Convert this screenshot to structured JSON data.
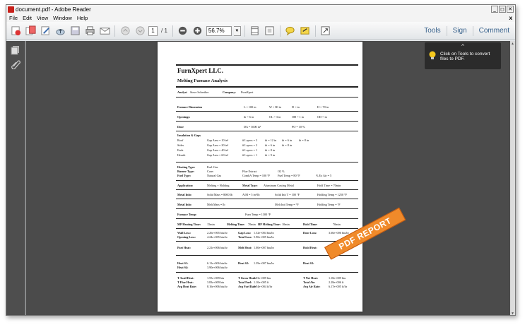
{
  "window": {
    "title": "document.pdf - Adobe Reader",
    "min": "_",
    "max": "◻",
    "close": "✕"
  },
  "menu": {
    "items": [
      "File",
      "Edit",
      "View",
      "Window",
      "Help"
    ],
    "close": "x"
  },
  "toolbar": {
    "page_current": "1",
    "page_total": "/ 1",
    "zoom": "56.7%",
    "zoom_dd": "▼",
    "links": [
      "Tools",
      "Sign",
      "Comment"
    ]
  },
  "tooltip": {
    "chevron": "^",
    "text": "Click on Tools to convert files to PDF."
  },
  "stamp": {
    "text": "PDF REPORT"
  },
  "scroll": {
    "up": "▲",
    "down": "▼"
  },
  "doc": {
    "company": "FurnXpert LLC.",
    "subtitle": "Melting Furnace Analysis",
    "analyst_label": "Analyst",
    "analyst": "Steve Schreiber",
    "company_label": "Company:",
    "company_value": "FurnXpert",
    "furnace_dim": {
      "label": "Furnace Dimension",
      "l": "L = 100 in",
      "w": "W = 80 in",
      "d": "D =  in",
      "h": "H = 70 in"
    },
    "openings": {
      "label": "Openings:",
      "a": "th = 6 in",
      "b": "OL = 3 in",
      "c": "OH = 1 in",
      "d": "OD =  in"
    },
    "door": {
      "label": "Door",
      "da": "DA = 3600 in²",
      "po": "PO = 10  %"
    },
    "insulation": {
      "label": "Insulation & Gaps",
      "rows": [
        [
          "Roof",
          "Gap Area = 10 in²",
          "# Layers = 3",
          "th = 12 in",
          "th = 6 in",
          "th = 8 in"
        ],
        [
          "Sides",
          "Gap Area = 20 in²",
          "# Layers = 2",
          "th = 6 in",
          "th = 8 in",
          ""
        ],
        [
          "Ends",
          "Gap Area = 40 in²",
          "# Layers = 1",
          "th = 8 in",
          "",
          ""
        ],
        [
          "Hearth",
          "Gap Area = 60 in²",
          "# Layers = 1",
          "th = 9 in",
          "",
          ""
        ]
      ]
    },
    "heating": [
      [
        "Heating Type:",
        "Fuel-Gas",
        "",
        "",
        ""
      ],
      [
        "Burner Type:",
        "Conv",
        "Flue Extract",
        "O2 %",
        ""
      ],
      [
        "Fuel Type:",
        "Natural Gas",
        "CombA Temp = 100 °F",
        "Fuel Temp = 80 °F",
        "% Ex Air = 5"
      ]
    ],
    "application": {
      "label": "Application:",
      "value": "Melting + Holding",
      "mt_label": "Metal Type:",
      "mt": "Aluminum Casting Metal",
      "ht": "Hold Time = 70min"
    },
    "metal_info1": {
      "label": "Metal Info:",
      "a": "Solid Mass = 8000 lb",
      "b": "A/M = 5 in²/lb",
      "c": "Solid Init T = 100 °F",
      "d": "Holding Temp = 1250 °F"
    },
    "metal_info2": {
      "label": "Metal Info:",
      "a": "Melt Mass =  lb",
      "c": "Melt Init Temp =  °F",
      "d": "Holding Temp =  °F"
    },
    "furnace_temp": {
      "label": "Furnace Temp:",
      "value": "Furn Temp = 1300 °F"
    },
    "times": {
      "mp_label": "MP Heating Time:",
      "mp": "15min",
      "melt_label": "Melting Time:",
      "melt": "70min",
      "hp_label": "HP Melting Time:",
      "hp": "10min",
      "hold_label": "Hold Time:",
      "hold": "70min"
    },
    "losses": [
      [
        "Wall Loss:",
        "2.26e+005 btu/hr",
        "Gap Loss:",
        "1.52e+004 btu/hr",
        "Door Loss:",
        "3.66e+006 btu/hr"
      ],
      [
        "Opening Loss:",
        "4.24e+005 btu/hr",
        "Total Loss:",
        "5.90e+005 btu/hr",
        "",
        ""
      ]
    ],
    "heats": [
      [
        "Part Heat:",
        "2.21e+006 btu/hr",
        "Melt Heat:",
        "1.00e+007 btu/hr",
        "Hold Heat:",
        "2.08e+005 btu/hr"
      ]
    ],
    "heat_s": [
      [
        "Heat S1:",
        "6.11e+006 btu/hr",
        "Heat S2:",
        "1.39e+007 btu/hr",
        "Heat S3:",
        ""
      ],
      [
        "Heat S4:",
        "3.90e+006 btu/hr",
        "",
        "",
        "",
        ""
      ]
    ],
    "totals": [
      [
        "T Avail Heat:",
        "1.55e+009 btu",
        "T Gross Heat:",
        "5.03e+009 btu",
        "T Net Heat:",
        "1.18e+009 btu"
      ],
      [
        "T Flue Heat:",
        "3.83e+009 btu",
        "Total Fuel:",
        "1.10e+005 ft",
        "Total Air:",
        "2.28e+006 ft"
      ],
      [
        "Avg Heat Rate:",
        "8.16e+006 btu/hr",
        "Avg Fuel Rate:",
        "3.74e+004 ft/hr",
        "Avg Air Rate:",
        "6.17e+005 ft/hr"
      ]
    ]
  }
}
